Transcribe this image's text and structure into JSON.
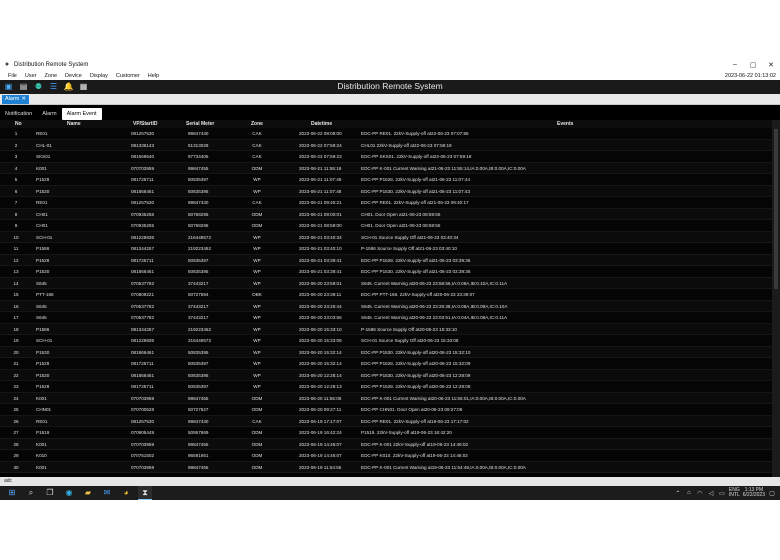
{
  "window": {
    "title": "Distribution Remote System",
    "minimize": "–",
    "maximize": "▢",
    "close": "✕"
  },
  "menu": {
    "items": [
      "File",
      "User",
      "Zone",
      "Device",
      "Display",
      "Customer",
      "Help"
    ],
    "clock": "2023-06-22 01:13:02"
  },
  "header": {
    "system_title": "Distribution Remote System"
  },
  "tabstrip": {
    "alarm_tab_label": "Alarm",
    "alarm_tab_close": "✕"
  },
  "subtabs": [
    {
      "label": "Notification"
    },
    {
      "label": "Alarm"
    },
    {
      "label": "Alarm Event"
    }
  ],
  "grid": {
    "headers": {
      "no": "No",
      "name": "Name",
      "vp": "VP/StartID",
      "serial": "Serial Meter",
      "zone": "Zone",
      "datetime": "Datetime",
      "events": "Events"
    },
    "rows": [
      {
        "no": "1",
        "name": "RE01",
        "vp": "081257530",
        "serial": "99847430",
        "zone": "CAK",
        "datetime": "2023-06-22 08:08:00",
        "event": "EDC-PP RE01. 22kV-Supply-off at22-06-23 07:07:55"
      },
      {
        "no": "2",
        "name": "CHL-01",
        "vp": "081336143",
        "serial": "51313028",
        "zone": "CAK",
        "datetime": "2023-06-22 07:59:24",
        "event": "CHL01 22kV-Supply-off at22-06-23 07:59:19"
      },
      {
        "no": "3",
        "name": "SKS01",
        "vp": "081569640",
        "serial": "97734405",
        "zone": "CAK",
        "datetime": "2023-06-22 07:59:23",
        "event": "EDC-PP SKS01. 22kV-Supply-off at22-06-23 07:59:18"
      },
      {
        "no": "4",
        "name": "K001",
        "vp": "070703959",
        "serial": "99847455",
        "zone": "ODM",
        "datetime": "2023-06-21 11:55:19",
        "event": "EDC-PP K-001 Current Warning at21-06-23 11:55:14,IA:0.00A,IB:0.00A,IC:0.00A"
      },
      {
        "no": "5",
        "name": "P1528",
        "vp": "081725711",
        "serial": "50835397",
        "zone": "WP",
        "datetime": "2023-06-21 11:07:49",
        "event": "EDC-PP P1528. 22kV-Supply-off at21-06-23 11:07:44"
      },
      {
        "no": "6",
        "name": "P1530",
        "vp": "081866461",
        "serial": "50835395",
        "zone": "WP",
        "datetime": "2023-06-21 11:07:48",
        "event": "EDC-PP P1530. 22kV-Supply-off at21-06-23 11:07:43"
      },
      {
        "no": "7",
        "name": "RE01",
        "vp": "081257530",
        "serial": "99847430",
        "zone": "CAK",
        "datetime": "2023-06-21 09:40:21",
        "event": "EDC-PP RE01. 22kV-Supply-off at21-06-23 09:40:17"
      },
      {
        "no": "8",
        "name": "CH01",
        "vp": "070935255",
        "serial": "50768295",
        "zone": "ODM",
        "datetime": "2023-06-21 09:00:01",
        "event": "CH01. Door Open at21-06-23 08:59:56"
      },
      {
        "no": "9",
        "name": "CH01",
        "vp": "070935255",
        "serial": "50768295",
        "zone": "ODM",
        "datetime": "2023-06-21 08:59:00",
        "event": "CH01. Door Open at21-06-23 08:58:55"
      },
      {
        "no": "10",
        "name": "SCH-01",
        "vp": "081229835",
        "serial": "216449572",
        "zone": "WP",
        "datetime": "2023-06-21 03:40:34",
        "event": "SCH-01 Source Supply Off at21-06-23 03:40:34"
      },
      {
        "no": "11",
        "name": "P1586",
        "vp": "081344257",
        "serial": "219223462",
        "zone": "WP",
        "datetime": "2023-06-21 03:40:10",
        "event": "P-1586 Source Supply Off at21-06-23 03:40:10"
      },
      {
        "no": "12",
        "name": "P1528",
        "vp": "081725711",
        "serial": "50835397",
        "zone": "WP",
        "datetime": "2023-06-21 03:39:41",
        "event": "EDC-PP P1528. 22kV-Supply-off at21-06-23 03:39:36"
      },
      {
        "no": "13",
        "name": "P1530",
        "vp": "081866461",
        "serial": "50835395",
        "zone": "WP",
        "datetime": "2023-06-21 03:39:41",
        "event": "EDC-PP P1530. 22kV-Supply-off at21-06-23 03:39:36"
      },
      {
        "no": "14",
        "name": "S645",
        "vp": "070537782",
        "serial": "37443217",
        "zone": "WP",
        "datetime": "2023-06-20 23:59:01",
        "event": "S645. Current Warning at20-06-23 23:58:56,IA:0.08A,IB:0.10A,IC:0.11A"
      },
      {
        "no": "15",
        "name": "PTT-166",
        "vp": "070809221",
        "serial": "50727594",
        "zone": "OBK",
        "datetime": "2023-06-20 23:39:11",
        "event": "EDC-PP PTT-166. 22kV-Supply-off at20-06-23 23:39:07"
      },
      {
        "no": "16",
        "name": "S645",
        "vp": "070537782",
        "serial": "37443217",
        "zone": "WP",
        "datetime": "2023-06-20 23:25:44",
        "event": "S645. Current Warning at20-06-23 23:25:38,IA:0.08A,IB:0.09A,IC:0.10A"
      },
      {
        "no": "17",
        "name": "S645",
        "vp": "070537782",
        "serial": "37443217",
        "zone": "WP",
        "datetime": "2023-06-20 23:03:56",
        "event": "S645. Current Warning at20-06-23 23:03:51,IA:0.04A,IB:0.08A,IC:0.11A"
      },
      {
        "no": "18",
        "name": "P1586",
        "vp": "081344257",
        "serial": "219223462",
        "zone": "WP",
        "datetime": "2023-06-20 15:33:10",
        "event": "P-1586 Source Supply Off at20-06-23 15:33:10"
      },
      {
        "no": "19",
        "name": "SCH-01",
        "vp": "081229835",
        "serial": "216449572",
        "zone": "WP",
        "datetime": "2023-06-20 15:33:08",
        "event": "SCH-01 Source Supply Off at20-06-23 15:33:08"
      },
      {
        "no": "20",
        "name": "P1530",
        "vp": "081866461",
        "serial": "50835395",
        "zone": "WP",
        "datetime": "2023-06-20 15:32:14",
        "event": "EDC-PP P1530. 22kV-Supply-off at20-06-23 15:32:10"
      },
      {
        "no": "21",
        "name": "P1528",
        "vp": "081725711",
        "serial": "50835397",
        "zone": "WP",
        "datetime": "2023-06-20 15:32:14",
        "event": "EDC-PP P1528. 22kV-Supply-off at20-06-23 15:32:09"
      },
      {
        "no": "22",
        "name": "P1530",
        "vp": "081866461",
        "serial": "50835395",
        "zone": "WP",
        "datetime": "2023-06-20 12:28:14",
        "event": "EDC-PP P1530. 22kV-Supply-off at20-06-23 12:28:09"
      },
      {
        "no": "23",
        "name": "P1528",
        "vp": "081725711",
        "serial": "50835397",
        "zone": "WP",
        "datetime": "2023-06-20 12:28:13",
        "event": "EDC-PP P1528. 22kV-Supply-off at20-06-23 12:28:08"
      },
      {
        "no": "24",
        "name": "K001",
        "vp": "070703959",
        "serial": "99847455",
        "zone": "ODM",
        "datetime": "2023-06-20 11:55:06",
        "event": "EDC-PP K-001 Current Warning at20-06-23 11:55:01,IA:0.00A,IB:0.00A,IC:0.00A"
      },
      {
        "no": "25",
        "name": "CHN01",
        "vp": "070700528",
        "serial": "50727627",
        "zone": "ODM",
        "datetime": "2023-06-20 09:27:11",
        "event": "EDC-PP CHN01. Door Open at20-06-23 09:27:06"
      },
      {
        "no": "26",
        "name": "RE01",
        "vp": "081257530",
        "serial": "99847430",
        "zone": "CAK",
        "datetime": "2023-06-19 17:17:07",
        "event": "EDC-PP RE01. 22kV-Supply-off at19-06-23 17:17:02"
      },
      {
        "no": "27",
        "name": "P1519",
        "vp": "070905449",
        "serial": "50957869",
        "zone": "ODM",
        "datetime": "2023-06-19 16:42:24",
        "event": "P1519. 22kV-Supply-off at19-06-23 16:42:20"
      },
      {
        "no": "28",
        "name": "K001",
        "vp": "070703959",
        "serial": "99847455",
        "zone": "ODM",
        "datetime": "2023-06-19 14:46:07",
        "event": "EDC-PP K-001 22kV-Supply-off at19-06-23 14:46:02"
      },
      {
        "no": "29",
        "name": "K010",
        "vp": "070751502",
        "serial": "96591661",
        "zone": "ODM",
        "datetime": "2023-06-19 14:46:07",
        "event": "EDC-PP K010. 22kV-Supply-off at19-06-23 14:46:02"
      },
      {
        "no": "30",
        "name": "K001",
        "vp": "070703959",
        "serial": "99847455",
        "zone": "ODM",
        "datetime": "2023-06-19 11:54:55",
        "event": "EDC-PP K-001 Current Warning at19-06-23 11:54:49,IA:0.00A,IB:0.00A,IC:0.00A"
      }
    ]
  },
  "statusbar": {
    "text": "adc"
  },
  "taskbar": {
    "lang_top": "ENG",
    "lang_bottom": "INTL",
    "time": "1:13 PM",
    "date": "6/22/2023"
  }
}
